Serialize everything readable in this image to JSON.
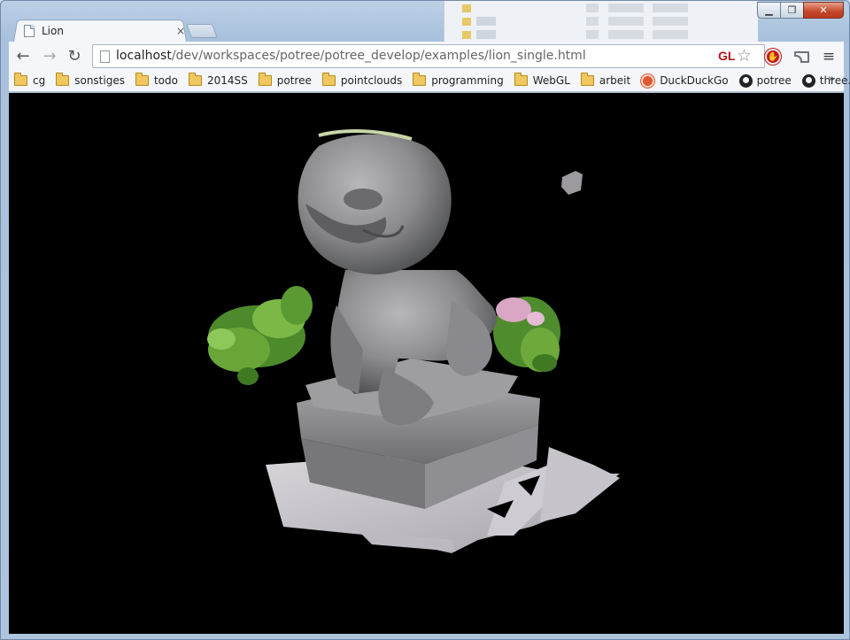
{
  "window": {
    "controls": {
      "minimize": "▁",
      "maximize": "❐",
      "close": "✕"
    }
  },
  "tab": {
    "title": "Lion",
    "close": "×"
  },
  "toolbar": {
    "back": "←",
    "forward": "→",
    "reload": "↻",
    "url_host": "localhost",
    "url_path": "/dev/workspaces/potree/potree_develop/examples/lion_single.html",
    "gl_badge": "GL",
    "star": "☆",
    "menu": "≡"
  },
  "bookmarks": [
    {
      "label": "cg",
      "icon": "folder-icon"
    },
    {
      "label": "sonstiges",
      "icon": "folder-icon"
    },
    {
      "label": "todo",
      "icon": "folder-icon"
    },
    {
      "label": "2014SS",
      "icon": "folder-icon"
    },
    {
      "label": "potree",
      "icon": "folder-icon"
    },
    {
      "label": "pointclouds",
      "icon": "folder-icon"
    },
    {
      "label": "programming",
      "icon": "folder-icon"
    },
    {
      "label": "WebGL",
      "icon": "folder-icon"
    },
    {
      "label": "arbeit",
      "icon": "folder-icon"
    },
    {
      "label": "DuckDuckGo",
      "icon": "duckduckgo-icon"
    },
    {
      "label": "potree",
      "icon": "github-icon"
    },
    {
      "label": "three.js",
      "icon": "github-icon"
    }
  ],
  "bookmarks_more": "»",
  "colors": {
    "viewport_bg": "#000000",
    "stone": "#8c8c8e",
    "foliage": "#5e9a32",
    "blossom": "#d9a7c4"
  }
}
